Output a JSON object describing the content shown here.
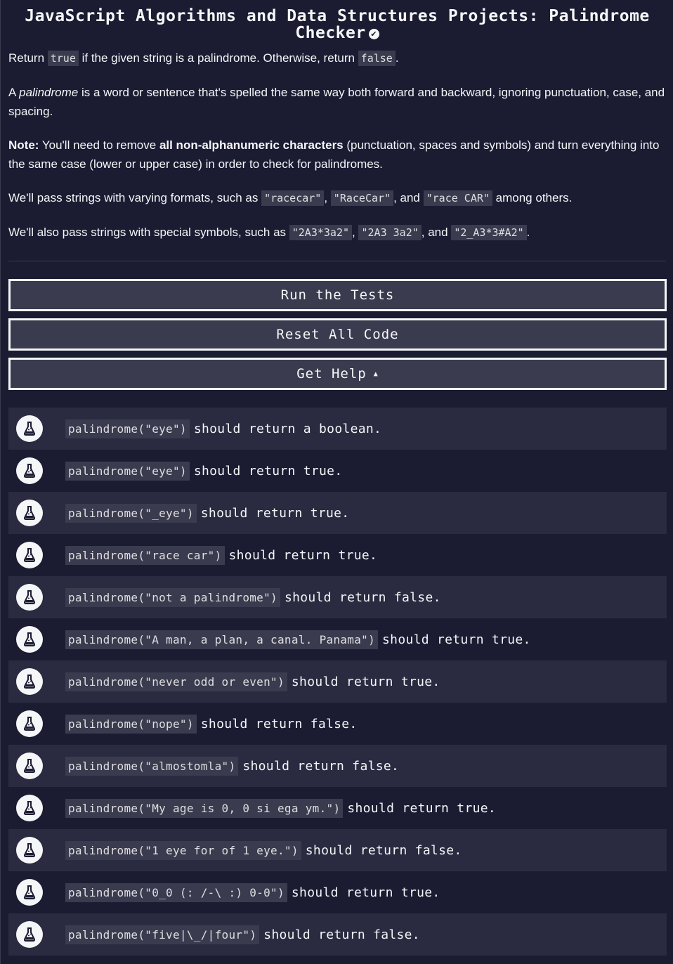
{
  "title": {
    "text": "JavaScript Algorithms and Data Structures Projects: Palindrome Checker",
    "check_icon": "✔"
  },
  "description": {
    "p1": {
      "t1": "Return ",
      "c1": "true",
      "t2": " if the given string is a palindrome. Otherwise, return ",
      "c2": "false",
      "t3": "."
    },
    "p2": {
      "t1": "A ",
      "em": "palindrome",
      "t2": " is a word or sentence that's spelled the same way both forward and backward, ignoring punctuation, case, and spacing."
    },
    "p3": {
      "b1": "Note:",
      "t1": " You'll need to remove ",
      "b2": "all non-alphanumeric characters",
      "t2": " (punctuation, spaces and symbols) and turn everything into the same case (lower or upper case) in order to check for palindromes."
    },
    "p4": {
      "t1": "We'll pass strings with varying formats, such as ",
      "c1": "\"racecar\"",
      "t2": ", ",
      "c2": "\"RaceCar\"",
      "t3": ", and ",
      "c3": "\"race CAR\"",
      "t4": " among others."
    },
    "p5": {
      "t1": "We'll also pass strings with special symbols, such as ",
      "c1": "\"2A3*3a2\"",
      "t2": ", ",
      "c2": "\"2A3 3a2\"",
      "t3": ", and ",
      "c3": "\"2_A3*3#A2\"",
      "t4": "."
    }
  },
  "buttons": {
    "run": "Run the Tests",
    "reset": "Reset All Code",
    "help": "Get Help",
    "help_caret": "▲"
  },
  "colors": {
    "background": "#1b1b32",
    "row_alt": "#2a2a40",
    "code_bg": "#3b3b4f",
    "text": "#f5f6f7"
  },
  "tests": [
    {
      "code": "palindrome(\"eye\")",
      "text": "should return a boolean."
    },
    {
      "code": "palindrome(\"eye\")",
      "text": "should return true."
    },
    {
      "code": "palindrome(\"_eye\")",
      "text": "should return true."
    },
    {
      "code": "palindrome(\"race car\")",
      "text": "should return true."
    },
    {
      "code": "palindrome(\"not a palindrome\")",
      "text": "should return false."
    },
    {
      "code": "palindrome(\"A man, a plan, a canal. Panama\")",
      "text": "should return true."
    },
    {
      "code": "palindrome(\"never odd or even\")",
      "text": "should return true."
    },
    {
      "code": "palindrome(\"nope\")",
      "text": "should return false."
    },
    {
      "code": "palindrome(\"almostomla\")",
      "text": "should return false."
    },
    {
      "code": "palindrome(\"My age is 0, 0 si ega ym.\")",
      "text": "should return true."
    },
    {
      "code": "palindrome(\"1 eye for of 1 eye.\")",
      "text": "should return false."
    },
    {
      "code": "palindrome(\"0_0 (: /-\\ :) 0-0\")",
      "text": "should return true."
    },
    {
      "code": "palindrome(\"five|\\_/|four\")",
      "text": "should return false."
    }
  ],
  "test_icon": "flask-icon"
}
